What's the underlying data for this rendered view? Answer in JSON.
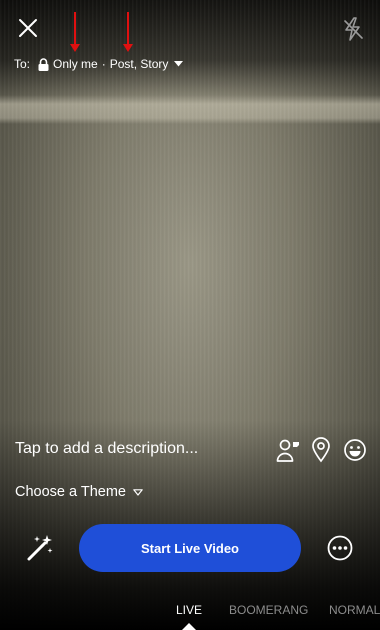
{
  "header": {
    "close_icon": "close-icon",
    "flash_icon": "flash-off-icon"
  },
  "audience": {
    "to_label": "To:",
    "privacy_icon": "lock-icon",
    "privacy_value": "Only me",
    "separator": "·",
    "destination_value": "Post, Story",
    "dropdown_icon": "caret-down-icon"
  },
  "annotations": {
    "arrow_color": "#e01010"
  },
  "composer": {
    "description_placeholder": "Tap to add a description...",
    "tag_people_icon": "tag-people-icon",
    "location_icon": "location-pin-icon",
    "feeling_icon": "smiley-icon"
  },
  "theme": {
    "label": "Choose a Theme",
    "dropdown_icon": "caret-down-icon"
  },
  "controls": {
    "effects_icon": "magic-wand-icon",
    "start_label": "Start Live Video",
    "start_color": "#1f4fd8",
    "more_icon": "more-options-icon"
  },
  "modes": {
    "items": [
      "LIVE",
      "BOOMERANG",
      "NORMAL"
    ],
    "selected": "LIVE"
  }
}
